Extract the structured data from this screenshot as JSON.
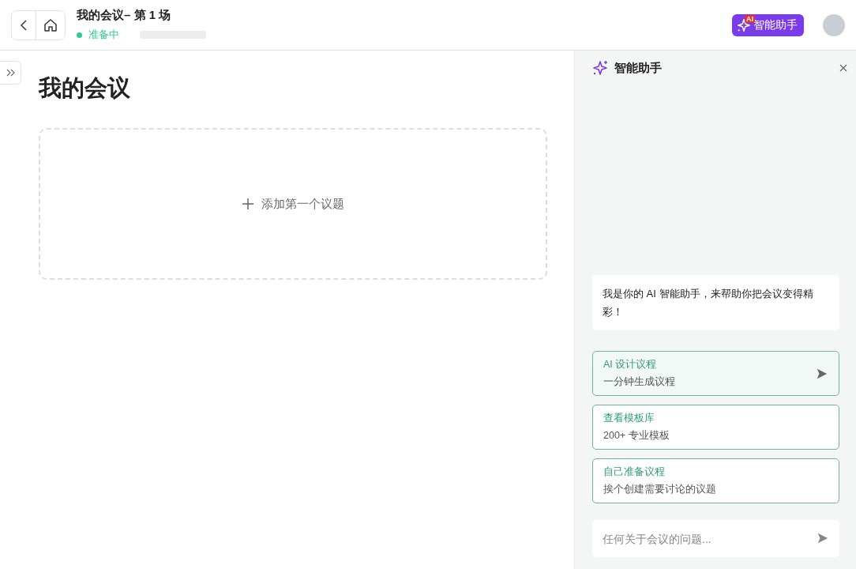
{
  "header": {
    "title": "我的会议– 第 1 场",
    "status": "准备中",
    "assistant_button": {
      "label": "智能助手",
      "badge": "AI"
    }
  },
  "main": {
    "heading": "我的会议",
    "add_topic": "添加第一个议题"
  },
  "assistant": {
    "title": "智能助手",
    "message": "我是你的 AI 智能助手，来帮助你把会议变得精彩！",
    "options": [
      {
        "title": "AI 设计议程",
        "subtitle": "一分钟生成议程",
        "selected": true
      },
      {
        "title": "查看模板库",
        "subtitle": "200+ 专业模板",
        "selected": false
      },
      {
        "title": "自己准备议程",
        "subtitle": "挨个创建需要讨论的议题",
        "selected": false
      }
    ],
    "input": {
      "placeholder": "任何关于会议的问题..."
    }
  }
}
